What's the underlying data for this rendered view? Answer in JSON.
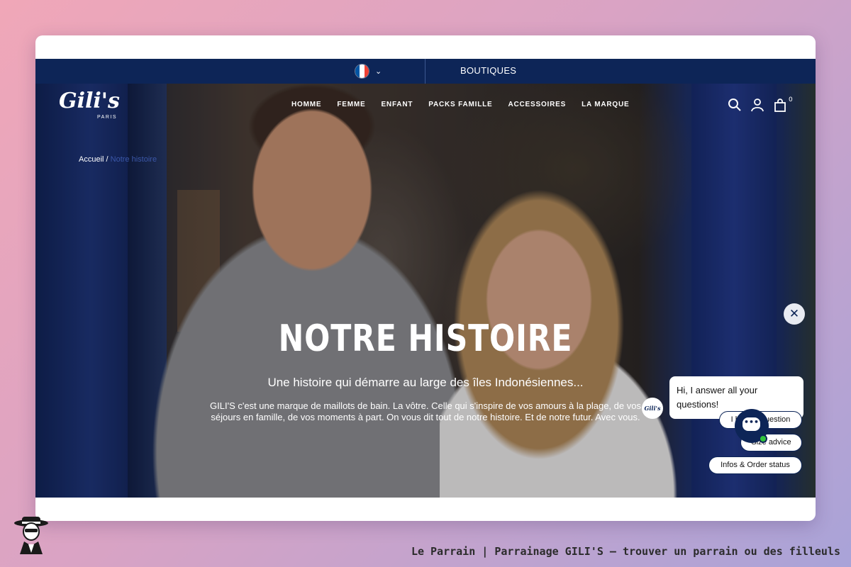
{
  "topbar": {
    "language_flag_colors": [
      "#0055a4",
      "#ffffff",
      "#ef4135"
    ],
    "language_chevron": "chevron-down-icon",
    "boutiques_label": "BOUTIQUES"
  },
  "header": {
    "logo_text": "Gili's",
    "logo_sub": "PARIS",
    "menu": [
      "HOMME",
      "FEMME",
      "ENFANT",
      "PACKS FAMILLE",
      "ACCESSOIRES",
      "LA MARQUE"
    ],
    "icons": [
      "search-icon",
      "user-icon",
      "bag-icon"
    ],
    "cart_count": "0"
  },
  "breadcrumb": {
    "home": "Accueil",
    "separator": " / ",
    "current": "Notre histoire"
  },
  "hero": {
    "title": "NOTRE HISTOIRE",
    "subtitle": "Une histoire qui démarre au large des îles Indonésiennes...",
    "description": "GILI'S c'est une marque de maillots de bain. La vôtre. Celle qui s'inspire de vos amours à la plage, de vos séjours en famille, de vos moments à part. On vous dit tout de notre histoire. Et de notre futur. Avec vous."
  },
  "chat": {
    "avatar_text": "Gili's",
    "greeting": "Hi, I answer all your questions!",
    "chips": [
      "I have a question",
      "Size advice",
      "Infos & Order status"
    ],
    "close_icon": "close-icon",
    "launcher_icon": "chat-bubble-icon",
    "online_color": "#2fc43b"
  },
  "colors": {
    "brand_navy": "#0d2557",
    "breadcrumb_current": "#3b57a8"
  },
  "footer": {
    "caption": "Le Parrain | Parrainage GILI'S — trouver un parrain ou des filleuls"
  }
}
